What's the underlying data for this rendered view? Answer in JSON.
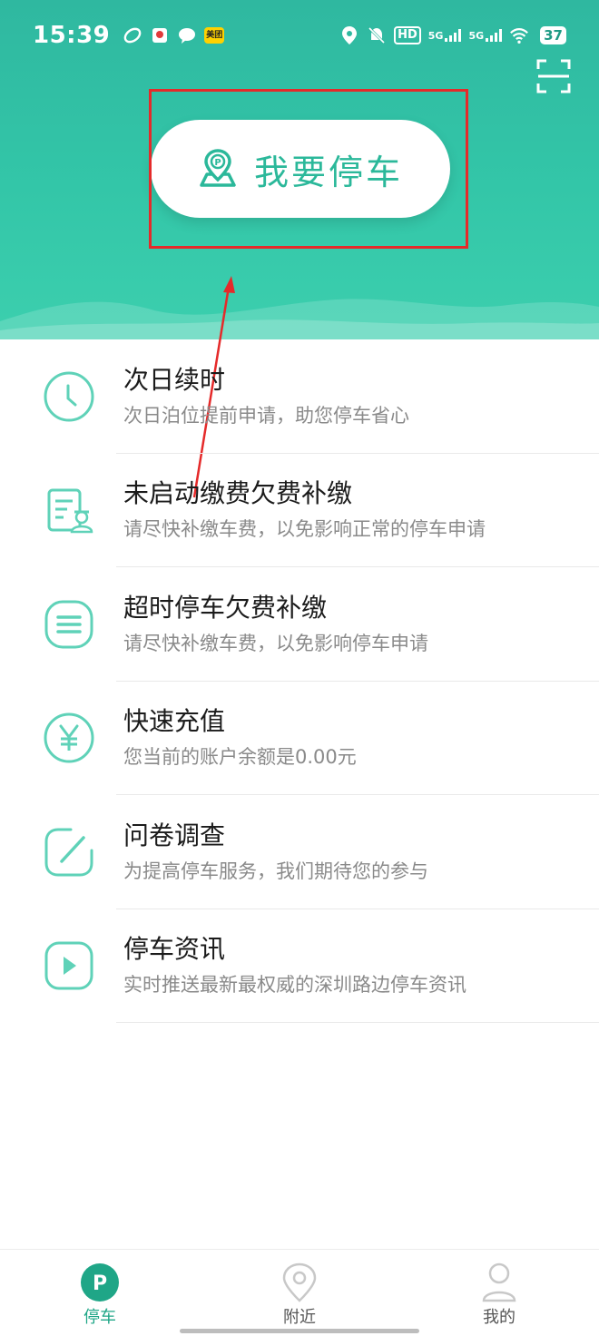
{
  "status_bar": {
    "time": "15:39",
    "meituan": "美团",
    "hd": "HD",
    "net1": "5G",
    "net2": "5G",
    "battery": "37"
  },
  "header": {
    "park_button_label": "我要停车",
    "park_icon_letter": "P"
  },
  "menu": [
    {
      "title": "次日续时",
      "subtitle": "次日泊位提前申请，助您停车省心",
      "icon": "clock-icon"
    },
    {
      "title": "未启动缴费欠费补缴",
      "subtitle": "请尽快补缴车费，以免影响正常的停车申请",
      "icon": "bill-officer-icon"
    },
    {
      "title": "超时停车欠费补缴",
      "subtitle": "请尽快补缴车费，以免影响停车申请",
      "icon": "list-icon"
    },
    {
      "title": "快速充值",
      "subtitle": "您当前的账户余额是0.00元",
      "icon": "yen-icon"
    },
    {
      "title": "问卷调查",
      "subtitle": "为提高停车服务，我们期待您的参与",
      "icon": "edit-icon"
    },
    {
      "title": "停车资讯",
      "subtitle": "实时推送最新最权威的深圳路边停车资讯",
      "icon": "play-icon"
    }
  ],
  "tabbar": {
    "tabs": [
      {
        "label": "停车",
        "icon_letter": "P",
        "active": true
      },
      {
        "label": "附近",
        "active": false
      },
      {
        "label": "我的",
        "active": false
      }
    ]
  },
  "colors": {
    "brand": "#2bb89a",
    "header_top": "#2fb8a0",
    "annotation": "#e52a2a",
    "icon_stroke": "#5fd2b8"
  }
}
